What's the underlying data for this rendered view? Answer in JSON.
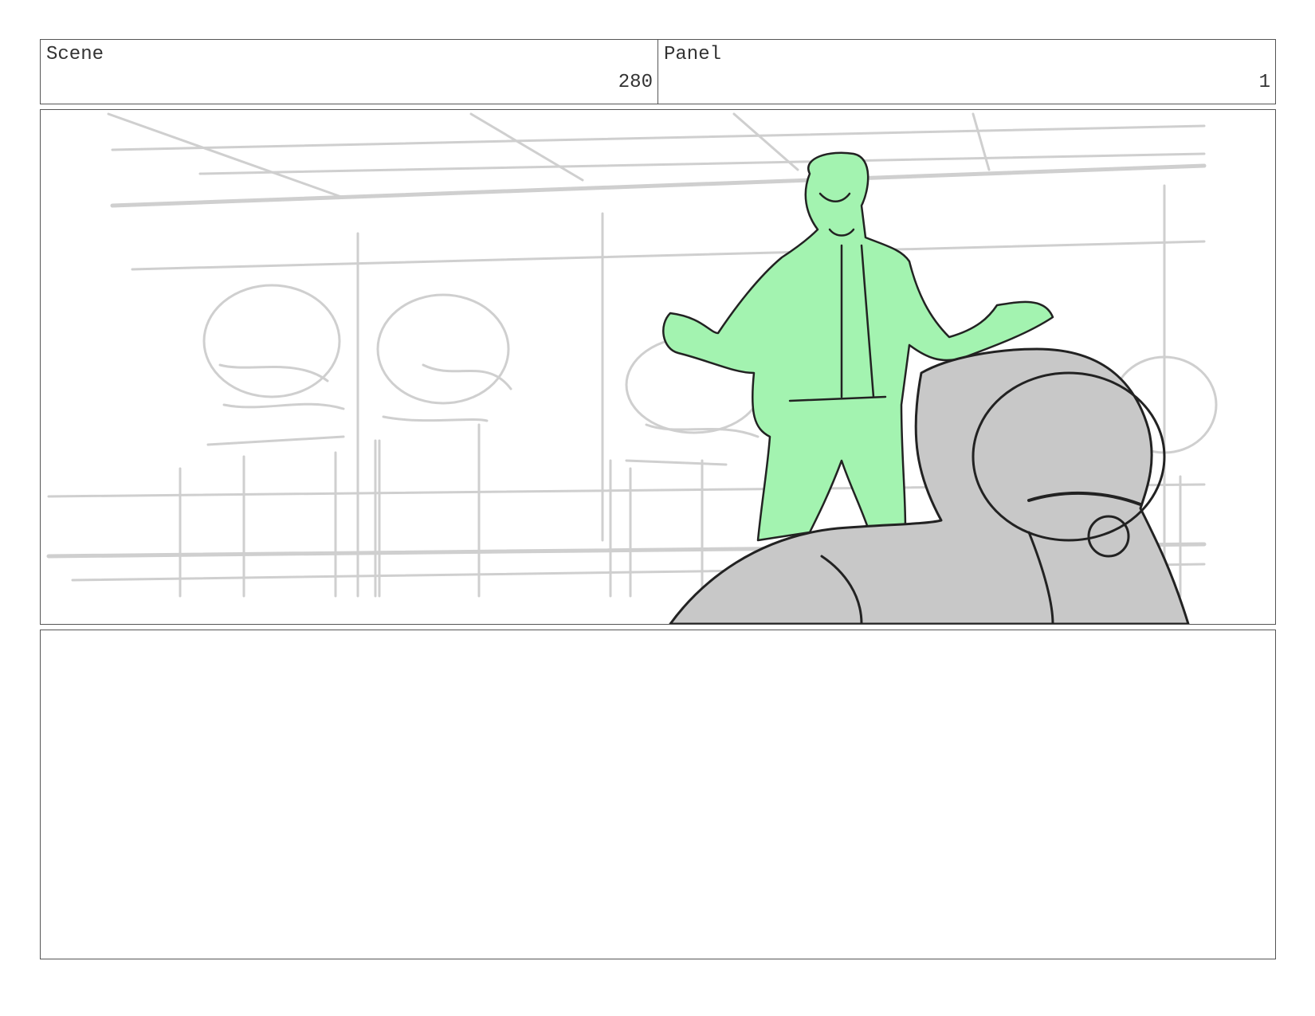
{
  "header": {
    "scene_label": "Scene",
    "scene_number": "280",
    "panel_label": "Panel",
    "panel_number": "1"
  },
  "colors": {
    "border": "#555555",
    "sketch_light": "#cfcfcf",
    "sketch_dark": "#222222",
    "figure_fill": "#a3f3b0",
    "foreground_fill": "#c8c8c8"
  },
  "frame": {
    "icon": "storyboard-sketch"
  },
  "notes": {
    "text": ""
  }
}
